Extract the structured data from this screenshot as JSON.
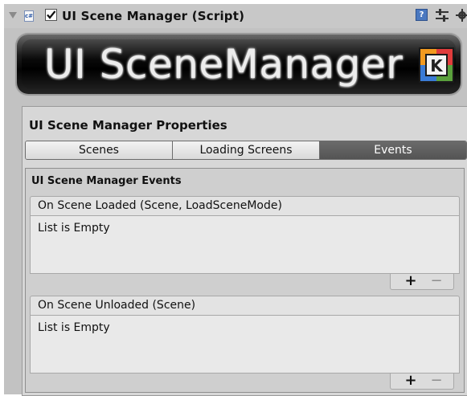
{
  "component": {
    "title": "UI Scene Manager (Script)",
    "enabled": true,
    "script_icon_text": "c#",
    "help_icon_text": "?"
  },
  "banner": {
    "title": "UI SceneManager",
    "logo_letter": "K"
  },
  "properties": {
    "title": "UI Scene Manager Properties",
    "tabs": [
      {
        "label": "Scenes",
        "active": false
      },
      {
        "label": "Loading Screens",
        "active": false
      },
      {
        "label": "Events",
        "active": true
      }
    ]
  },
  "events": {
    "title": "UI Scene Manager Events",
    "items": [
      {
        "header": "On Scene Loaded (Scene, LoadSceneMode)",
        "body": "List is Empty",
        "add_label": "+",
        "remove_label": "−"
      },
      {
        "header": "On Scene Unloaded (Scene)",
        "body": "List is Empty",
        "add_label": "+",
        "remove_label": "−"
      }
    ]
  },
  "colors": {
    "active_tab": "#5e5e5e",
    "panel_bg": "#c2c2c2",
    "logo_accent": [
      "#f29a1f",
      "#3a7bd5",
      "#5aa03c",
      "#e03c3c"
    ]
  }
}
